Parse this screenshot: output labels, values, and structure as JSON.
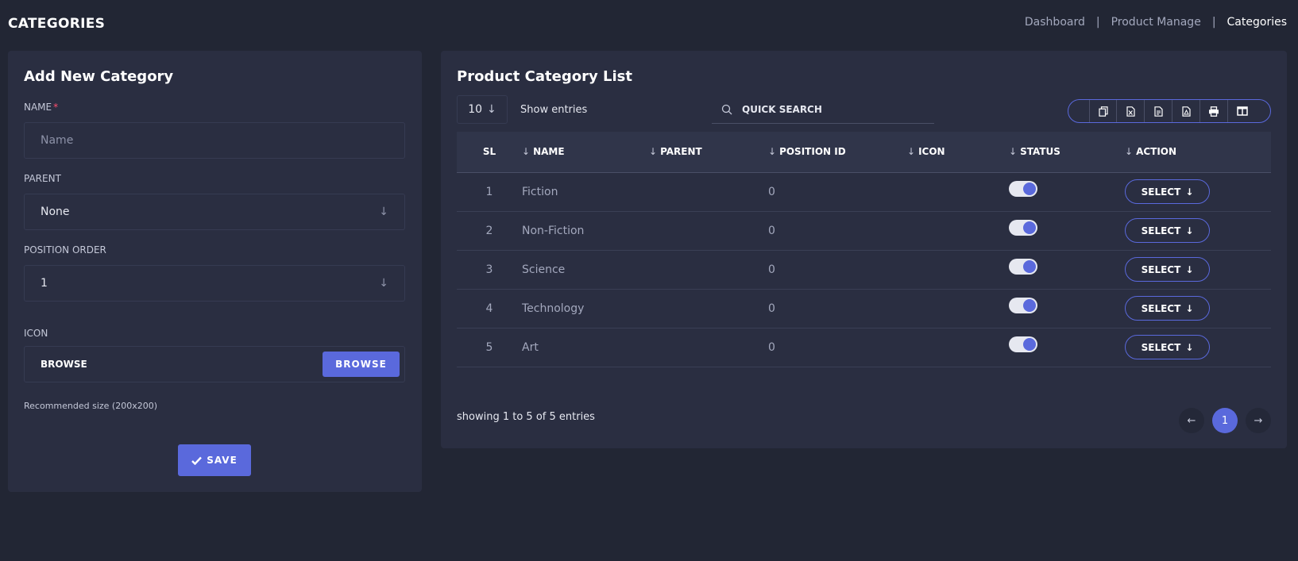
{
  "page": {
    "title": "CATEGORIES"
  },
  "breadcrumb": {
    "items": [
      "Dashboard",
      "Product Manage",
      "Categories"
    ],
    "separator": "|"
  },
  "form": {
    "title": "Add New Category",
    "name_label": "NAME",
    "name_required_mark": "*",
    "name_placeholder": "Name",
    "parent_label": "PARENT",
    "parent_value": "None",
    "position_label": "POSITION ORDER",
    "position_value": "1",
    "icon_label": "ICON",
    "icon_field_text": "BROWSE",
    "icon_button_label": "BROWSE",
    "hint": "Recommended size (200x200)",
    "save_label": "SAVE"
  },
  "list": {
    "title": "Product Category List",
    "entries_value": "10",
    "entries_label": "Show entries",
    "search_placeholder": "QUICK SEARCH",
    "export_icons": [
      "copy-icon",
      "excel-icon",
      "csv-icon",
      "pdf-icon",
      "print-icon",
      "columns-icon"
    ],
    "columns": [
      "SL",
      "NAME",
      "PARENT",
      "POSITION ID",
      "ICON",
      "STATUS",
      "ACTION"
    ],
    "rows": [
      {
        "sl": "1",
        "name": "Fiction",
        "parent": "",
        "position": "0",
        "icon": "",
        "status": true,
        "action": "SELECT"
      },
      {
        "sl": "2",
        "name": "Non-Fiction",
        "parent": "",
        "position": "0",
        "icon": "",
        "status": true,
        "action": "SELECT"
      },
      {
        "sl": "3",
        "name": "Science",
        "parent": "",
        "position": "0",
        "icon": "",
        "status": true,
        "action": "SELECT"
      },
      {
        "sl": "4",
        "name": "Technology",
        "parent": "",
        "position": "0",
        "icon": "",
        "status": true,
        "action": "SELECT"
      },
      {
        "sl": "5",
        "name": "Art",
        "parent": "",
        "position": "0",
        "icon": "",
        "status": true,
        "action": "SELECT"
      }
    ],
    "showing_text": "showing 1 to 5 of 5 entries",
    "current_page": "1"
  },
  "colors": {
    "accent": "#5a69dc",
    "background": "#222634",
    "panel": "#2a2e41"
  }
}
